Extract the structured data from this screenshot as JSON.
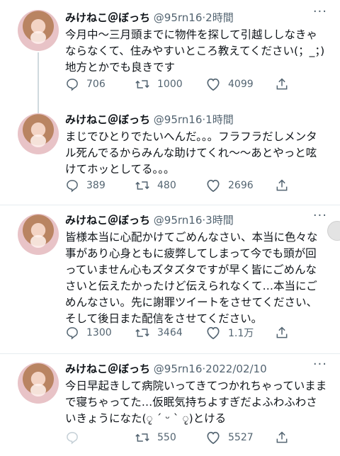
{
  "tweets": [
    {
      "name": "みけねこ＠ぼっち",
      "handle": "@95rn16",
      "time": "2時間",
      "text": "今月中〜三月頭までに物件を探して引越ししなきゃならなくて、住みやすいところ教えてください(；_；)\n地方とかでも良きです",
      "replies": "706",
      "retweets": "1000",
      "likes": "4099"
    },
    {
      "name": "みけねこ＠ぼっち",
      "handle": "@95rn16",
      "time": "1時間",
      "text": "まじでひとりでたいへんだ。。。フラフラだしメンタル死んでるからみんな助けてくれ〜〜あとやっと呟けてホッとしてる。。。",
      "replies": "389",
      "retweets": "480",
      "likes": "2696"
    },
    {
      "name": "みけねこ＠ぼっち",
      "handle": "@95rn16",
      "time": "3時間",
      "text": "皆様本当に心配かけてごめんなさい、本当に色々な事があり心身ともに疲弊してしまって今でも頭が回っていません心もズタズタですが早く皆にごめんなさいと伝えたかったけど伝えられなくて…本当にごめんなさい。先に謝罪ツイートをさせてください、そして後日また配信をさせてください。",
      "replies": "1300",
      "retweets": "3464",
      "likes": "1.1万"
    },
    {
      "name": "みけねこ＠ぼっち",
      "handle": "@95rn16",
      "time": "2022/02/10",
      "text": "今日早起きして病院いってきてつかれちゃっていままで寝ちゃってた…仮眠気持ちよすぎだよふわふわさいきょうになた(ृ ´ ᵕ ` ृ)とける",
      "replies": "",
      "retweets": "550",
      "likes": "5527"
    }
  ],
  "icons": {
    "reply": "reply-icon",
    "retweet": "retweet-icon",
    "like": "like-icon",
    "share": "share-icon",
    "more": "more-icon"
  },
  "more_glyph": "···",
  "separator": "·",
  "colors": {
    "text": "#0f1419",
    "muted": "#536471",
    "divider": "#e6ecf0"
  }
}
